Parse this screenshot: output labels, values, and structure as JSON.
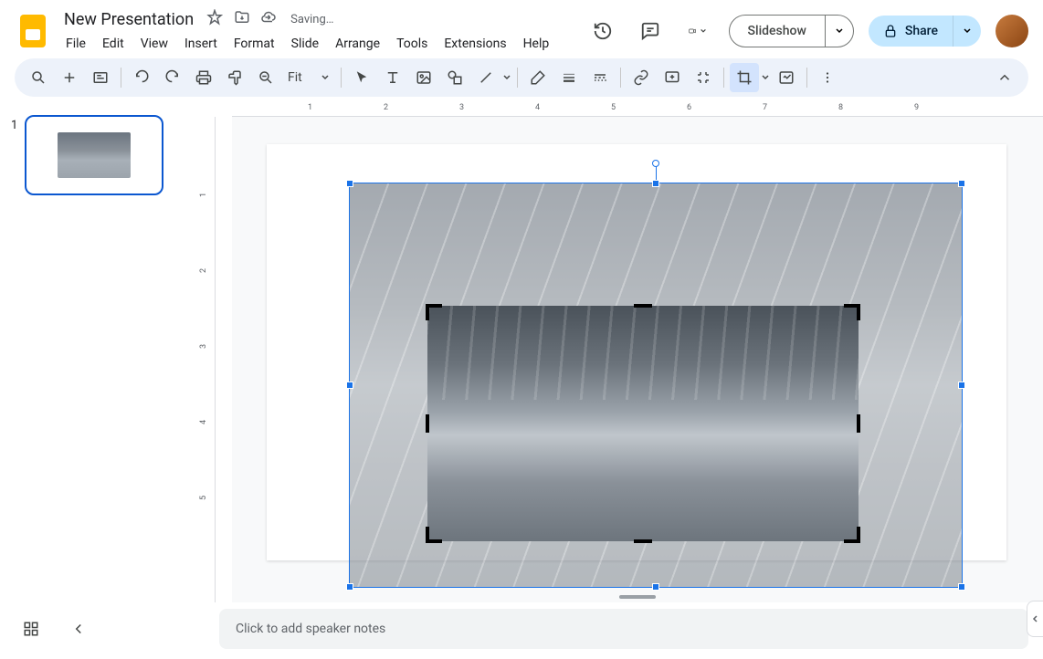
{
  "doc": {
    "title": "New Presentation",
    "status": "Saving…"
  },
  "menus": [
    "File",
    "Edit",
    "View",
    "Insert",
    "Format",
    "Slide",
    "Arrange",
    "Tools",
    "Extensions",
    "Help"
  ],
  "toolbar": {
    "zoom_label": "Fit"
  },
  "slideshow": {
    "label": "Slideshow"
  },
  "share": {
    "label": "Share"
  },
  "filmstrip": {
    "slides": [
      {
        "number": "1"
      }
    ]
  },
  "ruler": {
    "h_ticks": [
      "1",
      "2",
      "3",
      "4",
      "5",
      "6",
      "7",
      "8",
      "9"
    ],
    "v_ticks": [
      "1",
      "2",
      "3",
      "4",
      "5"
    ]
  },
  "notes": {
    "placeholder": "Click to add speaker notes"
  }
}
